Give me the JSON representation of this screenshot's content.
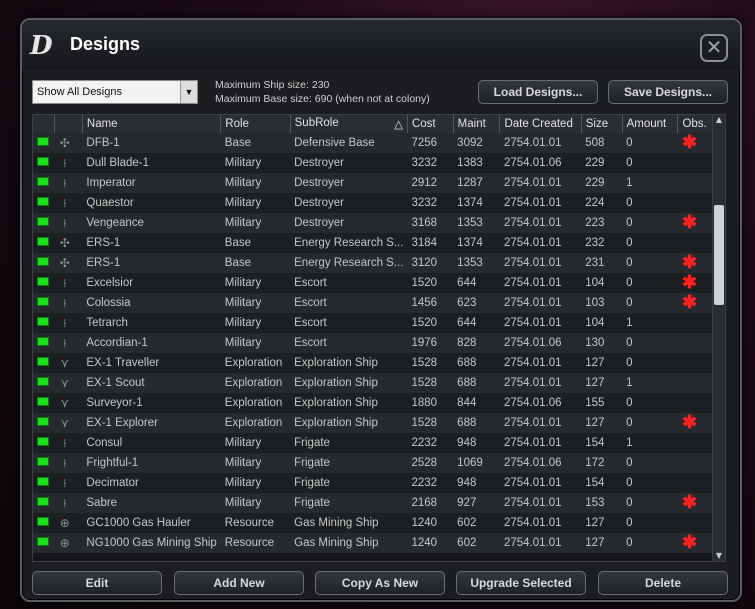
{
  "window": {
    "title": "Designs",
    "logo_text": "D",
    "close_symbol": "✕"
  },
  "filter": {
    "selected": "Show All Designs"
  },
  "info": {
    "ship_size": "Maximum Ship size: 230",
    "base_size": "Maximum Base size: 690 (when not at colony)"
  },
  "top_buttons": {
    "load": "Load Designs...",
    "save": "Save Designs..."
  },
  "columns": [
    "Name",
    "Role",
    "SubRole",
    "Cost",
    "Maint",
    "Date Created",
    "Size",
    "Amount",
    "Obs."
  ],
  "sort_indicator": "△",
  "icons": {
    "active": "green-led-icon",
    "obsolete_mark": "✱",
    "obsolete_color": "#ff2020"
  },
  "rows": [
    {
      "name": "DFB-1",
      "role": "Base",
      "subrole": "Defensive Base",
      "cost": "7256",
      "maint": "3092",
      "date": "2754.01.01",
      "size": "508",
      "amount": "0",
      "obsolete": true
    },
    {
      "name": "Dull Blade-1",
      "role": "Military",
      "subrole": "Destroyer",
      "cost": "3232",
      "maint": "1383",
      "date": "2754.01.06",
      "size": "229",
      "amount": "0",
      "obsolete": false
    },
    {
      "name": "Imperator",
      "role": "Military",
      "subrole": "Destroyer",
      "cost": "2912",
      "maint": "1287",
      "date": "2754.01.01",
      "size": "229",
      "amount": "1",
      "obsolete": false
    },
    {
      "name": "Quaestor",
      "role": "Military",
      "subrole": "Destroyer",
      "cost": "3232",
      "maint": "1374",
      "date": "2754.01.01",
      "size": "224",
      "amount": "0",
      "obsolete": false
    },
    {
      "name": "Vengeance",
      "role": "Military",
      "subrole": "Destroyer",
      "cost": "3168",
      "maint": "1353",
      "date": "2754.01.01",
      "size": "223",
      "amount": "0",
      "obsolete": true
    },
    {
      "name": "ERS-1",
      "role": "Base",
      "subrole": "Energy Research S...",
      "cost": "3184",
      "maint": "1374",
      "date": "2754.01.01",
      "size": "232",
      "amount": "0",
      "obsolete": false
    },
    {
      "name": "ERS-1",
      "role": "Base",
      "subrole": "Energy Research S...",
      "cost": "3120",
      "maint": "1353",
      "date": "2754.01.01",
      "size": "231",
      "amount": "0",
      "obsolete": true
    },
    {
      "name": "Excelsior",
      "role": "Military",
      "subrole": "Escort",
      "cost": "1520",
      "maint": "644",
      "date": "2754.01.01",
      "size": "104",
      "amount": "0",
      "obsolete": true
    },
    {
      "name": "Colossia",
      "role": "Military",
      "subrole": "Escort",
      "cost": "1456",
      "maint": "623",
      "date": "2754.01.01",
      "size": "103",
      "amount": "0",
      "obsolete": true
    },
    {
      "name": "Tetrarch",
      "role": "Military",
      "subrole": "Escort",
      "cost": "1520",
      "maint": "644",
      "date": "2754.01.01",
      "size": "104",
      "amount": "1",
      "obsolete": false
    },
    {
      "name": "Accordian-1",
      "role": "Military",
      "subrole": "Escort",
      "cost": "1976",
      "maint": "828",
      "date": "2754.01.06",
      "size": "130",
      "amount": "0",
      "obsolete": false
    },
    {
      "name": "EX-1 Traveller",
      "role": "Exploration",
      "subrole": "Exploration Ship",
      "cost": "1528",
      "maint": "688",
      "date": "2754.01.01",
      "size": "127",
      "amount": "0",
      "obsolete": false
    },
    {
      "name": "EX-1 Scout",
      "role": "Exploration",
      "subrole": "Exploration Ship",
      "cost": "1528",
      "maint": "688",
      "date": "2754.01.01",
      "size": "127",
      "amount": "1",
      "obsolete": false
    },
    {
      "name": "Surveyor-1",
      "role": "Exploration",
      "subrole": "Exploration Ship",
      "cost": "1880",
      "maint": "844",
      "date": "2754.01.06",
      "size": "155",
      "amount": "0",
      "obsolete": false
    },
    {
      "name": "EX-1 Explorer",
      "role": "Exploration",
      "subrole": "Exploration Ship",
      "cost": "1528",
      "maint": "688",
      "date": "2754.01.01",
      "size": "127",
      "amount": "0",
      "obsolete": true
    },
    {
      "name": "Consul",
      "role": "Military",
      "subrole": "Frigate",
      "cost": "2232",
      "maint": "948",
      "date": "2754.01.01",
      "size": "154",
      "amount": "1",
      "obsolete": false
    },
    {
      "name": "Frightful-1",
      "role": "Military",
      "subrole": "Frigate",
      "cost": "2528",
      "maint": "1069",
      "date": "2754.01.06",
      "size": "172",
      "amount": "0",
      "obsolete": false
    },
    {
      "name": "Decimator",
      "role": "Military",
      "subrole": "Frigate",
      "cost": "2232",
      "maint": "948",
      "date": "2754.01.01",
      "size": "154",
      "amount": "0",
      "obsolete": false
    },
    {
      "name": "Sabre",
      "role": "Military",
      "subrole": "Frigate",
      "cost": "2168",
      "maint": "927",
      "date": "2754.01.01",
      "size": "153",
      "amount": "0",
      "obsolete": true
    },
    {
      "name": "GC1000 Gas Hauler",
      "role": "Resource",
      "subrole": "Gas Mining Ship",
      "cost": "1240",
      "maint": "602",
      "date": "2754.01.01",
      "size": "127",
      "amount": "0",
      "obsolete": false
    },
    {
      "name": "NG1000 Gas Mining Ship",
      "role": "Resource",
      "subrole": "Gas Mining Ship",
      "cost": "1240",
      "maint": "602",
      "date": "2754.01.01",
      "size": "127",
      "amount": "0",
      "obsolete": true
    }
  ],
  "bottom_buttons": {
    "edit": "Edit",
    "add_new": "Add New",
    "copy_as_new": "Copy As New",
    "upgrade_selected": "Upgrade Selected",
    "delete": "Delete"
  }
}
